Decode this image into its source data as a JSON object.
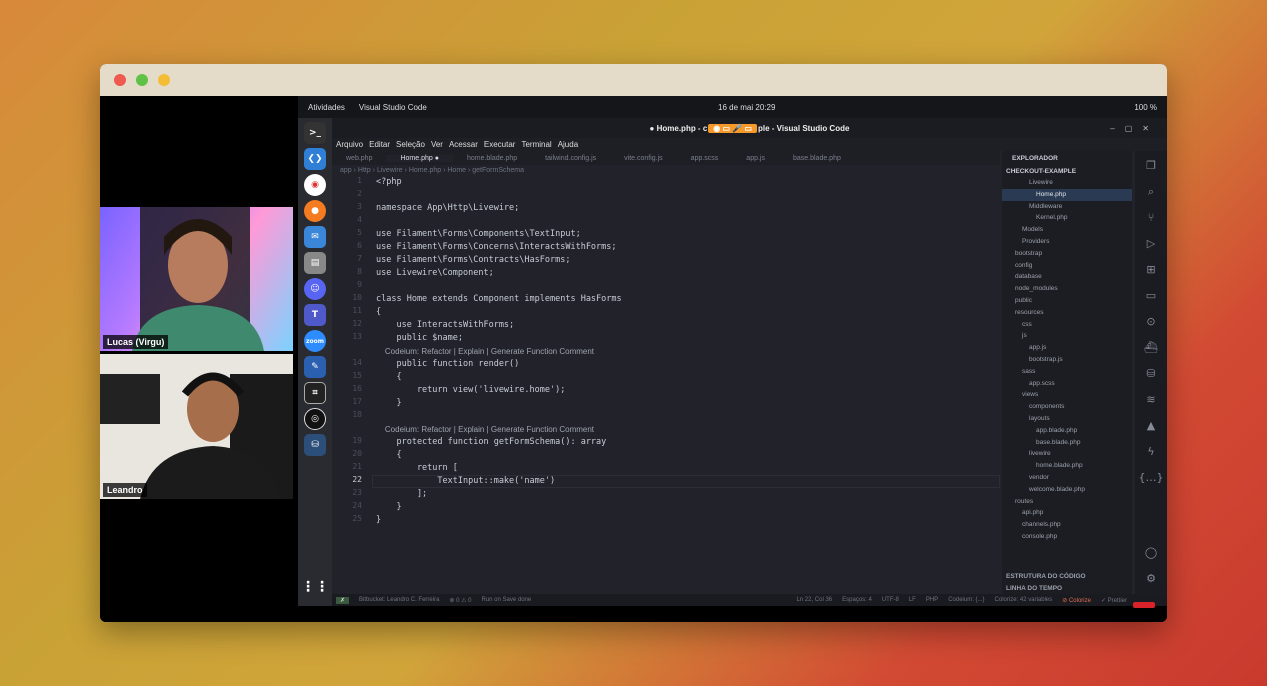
{
  "participants": [
    {
      "name": "Lucas (Virgu)"
    },
    {
      "name": "Leandro"
    }
  ],
  "topbar": {
    "activities": "Atividades",
    "app": "Visual Studio Code",
    "date": "16 de mai",
    "time": "20:29",
    "battery": "100 %"
  },
  "window": {
    "title": "● Home.php - c",
    "title_suffix": "ple - Visual Studio Code"
  },
  "menu": [
    "Arquivo",
    "Editar",
    "Seleção",
    "Ver",
    "Acessar",
    "Executar",
    "Terminal",
    "Ajuda"
  ],
  "tabs": [
    {
      "label": "web.php"
    },
    {
      "label": "Home.php ●"
    },
    {
      "label": "home.blade.php"
    },
    {
      "label": "tailwind.config.js"
    },
    {
      "label": "vite.config.js"
    },
    {
      "label": "app.scss"
    },
    {
      "label": "app.js"
    },
    {
      "label": "base.blade.php"
    }
  ],
  "breadcrumb": "app › Http › Livewire › Home.php › Home › getFormSchema",
  "editor": {
    "current_line": "22",
    "lines": [
      "<?php",
      "",
      "namespace App\\Http\\Livewire;",
      "",
      "use Filament\\Forms\\Components\\TextInput;",
      "use Filament\\Forms\\Concerns\\InteractsWithForms;",
      "use Filament\\Forms\\Contracts\\HasForms;",
      "use Livewire\\Component;",
      "",
      "class Home extends Component implements HasForms",
      "{",
      "    use InteractsWithForms;",
      "    public $name;",
      "    Codeium: Refactor | Explain | Generate Function Comment",
      "    public function render()",
      "    {",
      "        return view('livewire.home');",
      "    }",
      "",
      "    Codeium: Refactor | Explain | Generate Function Comment",
      "    protected function getFormSchema(): array",
      "    {",
      "        return [",
      "            TextInput::make('name')",
      "        ];",
      "    }",
      "}"
    ]
  },
  "explorer": {
    "title": "EXPLORADOR",
    "root": "CHECKOUT-EXAMPLE",
    "items": [
      "Livewire",
      "Home.php",
      "Middleware",
      "Kernel.php",
      "Models",
      "Providers",
      "bootstrap",
      "config",
      "database",
      "node_modules",
      "public",
      "resources",
      "css",
      "js",
      "app.js",
      "bootstrap.js",
      "sass",
      "app.scss",
      "views",
      "components",
      "layouts",
      "app.blade.php",
      "base.blade.php",
      "livewire",
      "home.blade.php",
      "vendor",
      "welcome.blade.php",
      "routes",
      "api.php",
      "channels.php",
      "console.php"
    ],
    "outline": "ESTRUTURA DO CÓDIGO",
    "timeline": "LINHA DO TEMPO"
  },
  "status": {
    "branch": "Bitbucket: Leandro C. Ferreira",
    "problems": "⊗ 0 ⚠ 0",
    "run": "Run on Save done",
    "position": "Ln 22, Col 36",
    "spaces": "Espaços: 4",
    "encoding": "UTF-8",
    "eol": "LF",
    "lang": "PHP",
    "codeium": "Codeium: {...}",
    "colorize": "Colorize: 42 variables",
    "colorize_btn": "⊘ Colorize",
    "prettier": "✓ Prettier"
  }
}
